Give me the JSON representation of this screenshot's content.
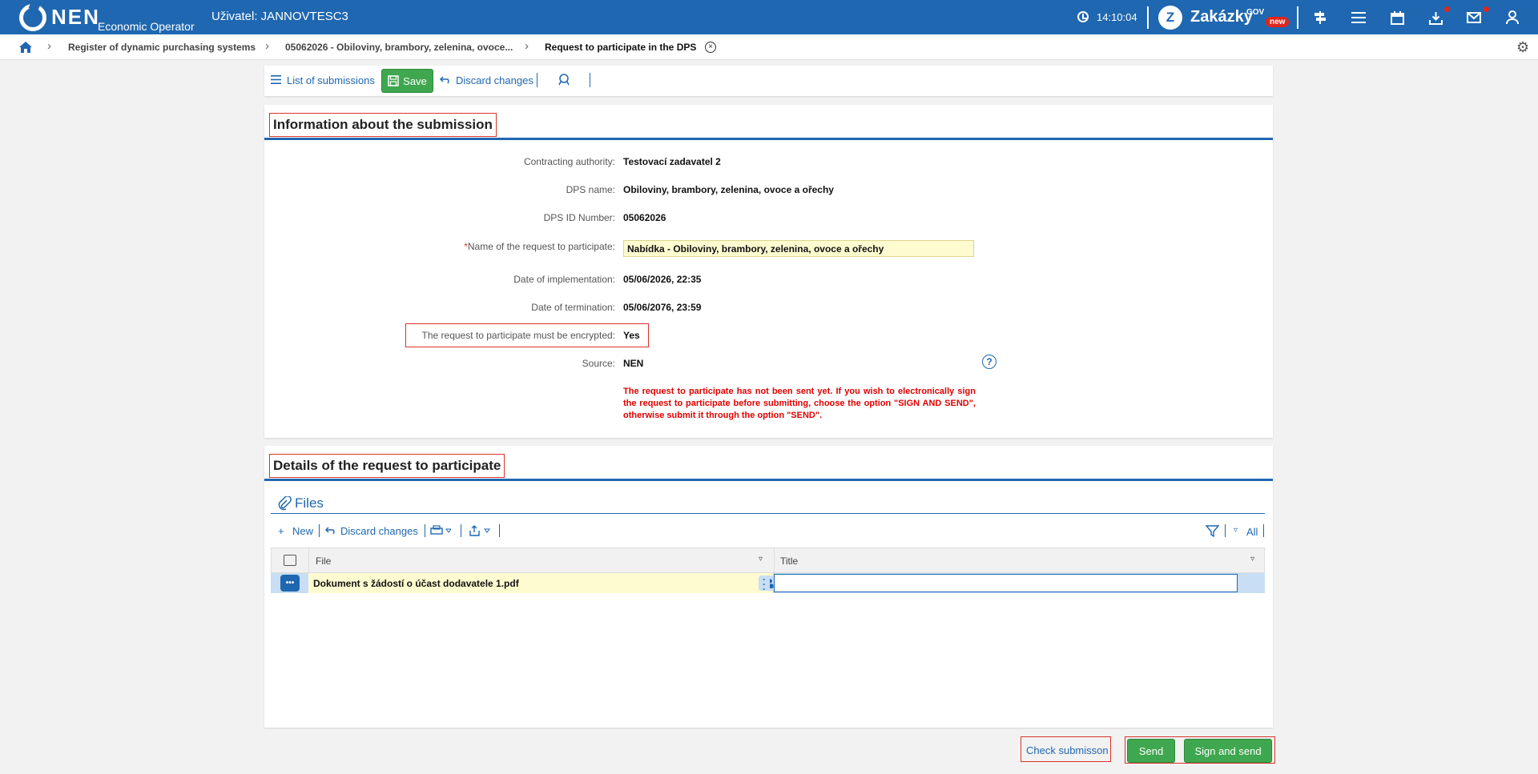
{
  "header": {
    "brand": "NEN",
    "brand_sub": "Economic Operator",
    "user": "Uživatel: JANNOVTESC3",
    "time": "14:10:04",
    "zakazky": "Zakázky",
    "zakazky_gov": "GOV",
    "new_badge": "new",
    "accent_color": "#1f67b0"
  },
  "breadcrumb": {
    "items": [
      "Register of dynamic purchasing systems",
      "05062026 - Obiloviny, brambory, zelenina, ovoce...",
      "Request to participate in the DPS"
    ]
  },
  "toolbar": {
    "list_label": "List of submissions",
    "save_label": "Save",
    "discard_label": "Discard changes"
  },
  "info": {
    "title": "Information about the submission",
    "fields": [
      {
        "label": "Contracting authority:",
        "value": "Testovací zadavatel 2"
      },
      {
        "label": "DPS name:",
        "value": "Obiloviny, brambory, zelenina, ovoce a ořechy"
      },
      {
        "label": "DPS ID Number:",
        "value": "05062026"
      },
      {
        "label": "Name of the request to participate:",
        "value": "Nabídka - Obiloviny, brambory, zelenina, ovoce a ořechy"
      },
      {
        "label": "Date of implementation:",
        "value": "05/06/2026, 22:35"
      },
      {
        "label": "Date of termination:",
        "value": "05/06/2076, 23:59"
      },
      {
        "label": "The request to participate must be encrypted:",
        "value": "Yes"
      },
      {
        "label": "Source:",
        "value": "NEN"
      }
    ],
    "required_mark": "*",
    "warning": "The request to participate has not been sent yet. If you wish to electronically sign the request to participate before submitting, choose the option \"SIGN AND SEND\", otherwise submit it through the option \"SEND\"."
  },
  "details": {
    "title": "Details of the request to participate",
    "files_title": "Files",
    "new_label": "New",
    "discard_label": "Discard changes",
    "filter_all": "All",
    "columns": [
      "File",
      "Title"
    ],
    "rows": [
      {
        "file": "Dokument s žádostí o účast dodavatele 1.pdf",
        "title": ""
      }
    ]
  },
  "footer": {
    "check_label": "Check submisson",
    "send_label": "Send",
    "sign_send_label": "Sign and send",
    "button_color": "#3fa74f"
  }
}
